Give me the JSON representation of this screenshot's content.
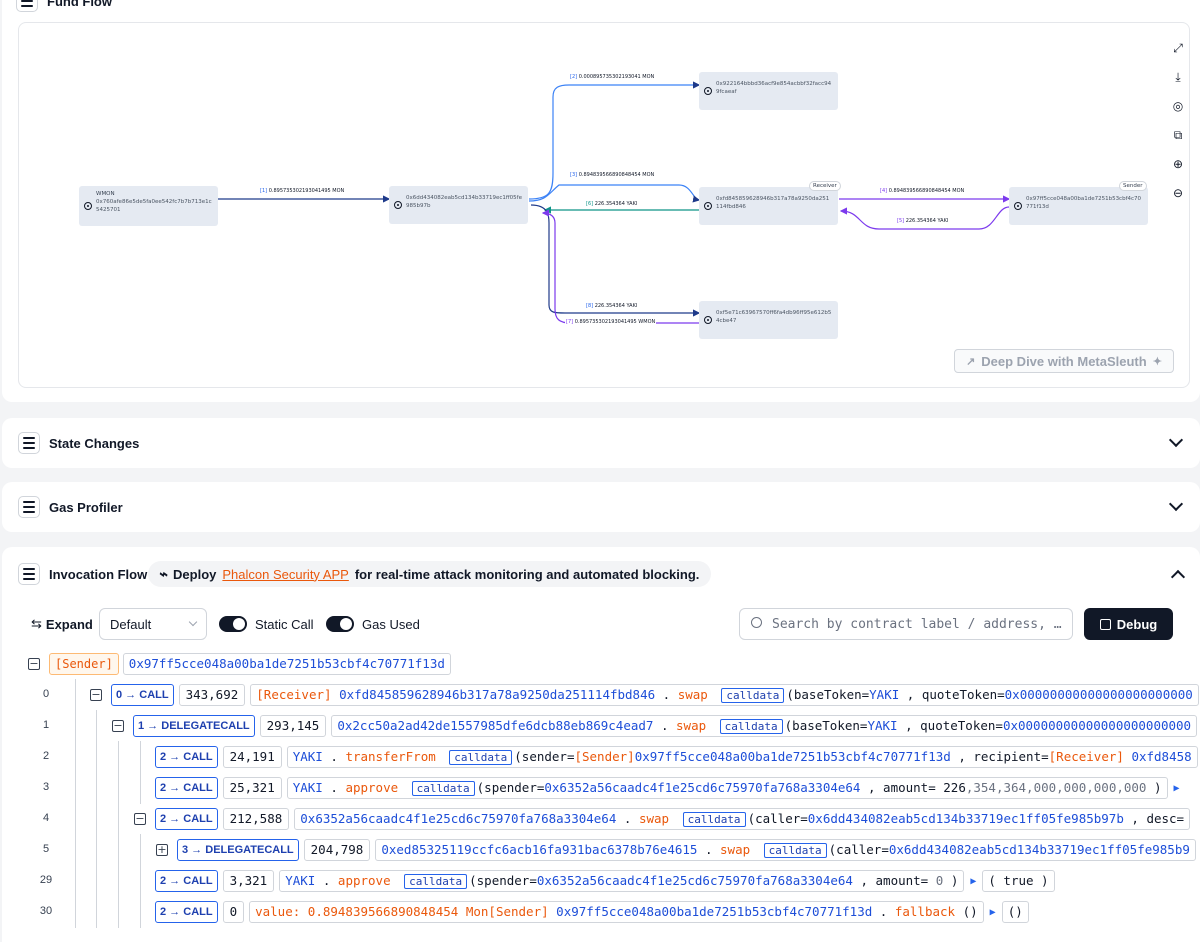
{
  "fund_flow": {
    "title": "Fund Flow",
    "nodes": {
      "wmon": {
        "name": "WMON",
        "address": "0x760afe86e5de5fa0ee542fc7b7b713e1c5425701"
      },
      "router": {
        "address": "0x6dd434082eab5cd134b33719ec1ff05fe985b97b"
      },
      "top": {
        "address": "0x922164bbbd36acf9e854acbbf32facc949fcaeaf"
      },
      "receiver": {
        "address": "0xfd845859628946b317a78a9250da251114fbd846",
        "tag": "Receiver"
      },
      "sender": {
        "address": "0x97ff5cce048a00ba1de7251b53cbf4c70771f13d",
        "tag": "Sender"
      },
      "bottom": {
        "address": "0xf5e71c63967570ff6fa4db96ff95e612b54cbe47"
      }
    },
    "edges": {
      "e1": {
        "idx": "[1]",
        "amount": "0.895735302193041495 MON"
      },
      "e2": {
        "idx": "[2]",
        "amount": "0.000895735302193041 MON"
      },
      "e3": {
        "idx": "[3]",
        "amount": "0.894839566890848454 MON"
      },
      "e4": {
        "idx": "[4]",
        "amount": "0.894839566890848454 MON"
      },
      "e5": {
        "idx": "[5]",
        "amount": "226.354364 YAKI"
      },
      "e6": {
        "idx": "[6]",
        "amount": "226.354364 YAKI"
      },
      "e7": {
        "idx": "[7]",
        "amount": "0.895735302193041495 WMON"
      },
      "e8": {
        "idx": "[8]",
        "amount": "226.354364 YAKI"
      }
    },
    "deep_dive_label": "Deep Dive with MetaSleuth",
    "tools": [
      "expand-icon",
      "download-icon",
      "target-icon",
      "copy-icon",
      "zoom-in-icon",
      "zoom-out-icon"
    ]
  },
  "sections": {
    "state_changes": "State Changes",
    "gas_profiler": "Gas Profiler",
    "invocation_flow": "Invocation Flow"
  },
  "promo": {
    "prefix": "Deploy",
    "link": "Phalcon Security APP",
    "suffix": "for real-time attack monitoring and automated blocking."
  },
  "controls": {
    "expand_label": "Expand",
    "select_value": "Default",
    "static_call_label": "Static Call",
    "static_call_on": true,
    "gas_used_label": "Gas Used",
    "gas_used_on": true,
    "search_placeholder": "Search by contract label / address, …",
    "debug_label": "Debug"
  },
  "trace": {
    "root": {
      "tag": "[Sender]",
      "address": "0x97ff5cce048a00ba1de7251b53cbf4c70771f13d"
    },
    "rows": [
      {
        "n": "0",
        "depth": "0",
        "type": "CALL",
        "gas": "343,692",
        "label": "[Receiver]",
        "target": "0xfd845859628946b317a78a9250da251114fbd846",
        "dot": ".",
        "fn": "swap",
        "cd": "calldata",
        "args": "(baseToken=",
        "a1": "YAKI",
        "sep": ",",
        "k2": "quoteToken=",
        "a2": "0x00000000000000000000000"
      },
      {
        "n": "1",
        "depth": "1",
        "type": "DELEGATECALL",
        "gas": "293,145",
        "target": "0x2cc50a2ad42de1557985dfe6dcb88eb869c4ead7",
        "dot": ".",
        "fn": "swap",
        "cd": "calldata",
        "args": "(baseToken=",
        "a1": "YAKI",
        "sep": ",",
        "k2": "quoteToken=",
        "a2": "0x00000000000000000000000"
      },
      {
        "n": "2",
        "depth": "2",
        "type": "CALL",
        "gas": "24,191",
        "target": "YAKI",
        "dot": ".",
        "fn": "transferFrom",
        "cd": "calldata",
        "args": "(sender=",
        "a1l": "[Sender]",
        "a1": "0x97ff5cce048a00ba1de7251b53cbf4c70771f13d",
        "sep": ",",
        "k2": "recipient=",
        "a2l": "[Receiver]",
        "a2": "0xfd8458"
      },
      {
        "n": "3",
        "depth": "2",
        "type": "CALL",
        "gas": "25,321",
        "target": "YAKI",
        "dot": ".",
        "fn": "approve",
        "cd": "calldata",
        "args": "(spender=",
        "a1": "0x6352a56caadc4f1e25cd6c75970fa768a3304e64",
        "sep": ",",
        "k2": "amount=",
        "a2": "226",
        "a2g": ",354,364,000,000,000,000",
        "close": ")"
      },
      {
        "n": "4",
        "depth": "2",
        "type": "CALL",
        "gas": "212,588",
        "target": "0x6352a56caadc4f1e25cd6c75970fa768a3304e64",
        "dot": ".",
        "fn": "swap",
        "cd": "calldata",
        "args": "(caller=",
        "a1": "0x6dd434082eab5cd134b33719ec1ff05fe985b97b",
        "sep": ",",
        "k2": "desc="
      },
      {
        "n": "5",
        "depth": "3",
        "type": "DELEGATECALL",
        "gas": "204,798",
        "target": "0xed85325119ccfc6acb16fa931bac6378b76e4615",
        "dot": ".",
        "fn": "swap",
        "cd": "calldata",
        "args": "(caller=",
        "a1": "0x6dd434082eab5cd134b33719ec1ff05fe985b9"
      },
      {
        "n": "29",
        "depth": "2",
        "type": "CALL",
        "gas": "3,321",
        "target": "YAKI",
        "dot": ".",
        "fn": "approve",
        "cd": "calldata",
        "args": "(spender=",
        "a1": "0x6352a56caadc4f1e25cd6c75970fa768a3304e64",
        "sep": ",",
        "k2": "amount=",
        "a2": "0",
        "close": ")",
        "ret": "( true )"
      },
      {
        "n": "30",
        "depth": "2",
        "type": "CALL",
        "gas": "0",
        "value_label": "value:",
        "value": "0.894839566890848454",
        "unit": "Mon",
        "label": "[Sender]",
        "target": "0x97ff5cce048a00ba1de7251b53cbf4c70771f13d",
        "dot": ".",
        "fn": "fallback",
        "args": "()",
        "ret": "()"
      }
    ]
  }
}
